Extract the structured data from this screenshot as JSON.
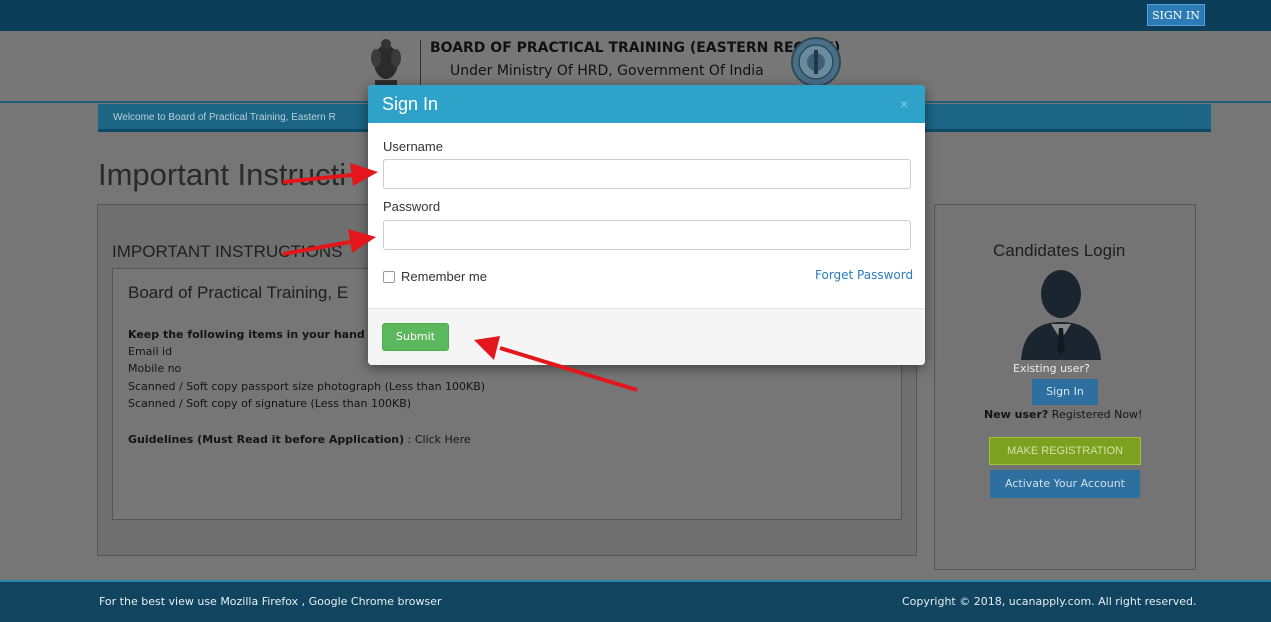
{
  "topbar": {
    "signin_label": "SIGN IN"
  },
  "header": {
    "title": "BOARD OF PRACTICAL TRAINING (EASTERN REGION)",
    "subtitle": "Under Ministry Of HRD, Government Of India"
  },
  "welcome": {
    "text": "Welcome to Board of Practical Training, Eastern R"
  },
  "page": {
    "title": "Important Instructi"
  },
  "instructions": {
    "heading": "IMPORTANT INSTRUCTIONS",
    "inner_title": "Board of Practical Training, E",
    "keep_label": "Keep the following items in your hand b",
    "items": [
      "Email id",
      "Mobile no",
      "Scanned / Soft copy passport size photograph (Less than 100KB)",
      "Scanned / Soft copy of signature (Less than 100KB)"
    ],
    "guidelines_label": "Guidelines (Must Read it before Application)",
    "guidelines_sep": " : ",
    "guidelines_link": "Click Here"
  },
  "login_panel": {
    "title": "Candidates Login",
    "existing_user": "Existing user?",
    "signin_label": "Sign In",
    "new_user_bold": "New user?",
    "new_user_text": " Registered Now!",
    "make_registration": "MAKE REGISTRATION",
    "activate_account": "Activate Your Account"
  },
  "footer": {
    "left": "For the best view use Mozilla Firefox , Google Chrome browser",
    "right": "Copyright © 2018, ucanapply.com. All right reserved."
  },
  "modal": {
    "title": "Sign In",
    "close": "×",
    "username_label": "Username",
    "username_value": "",
    "password_label": "Password",
    "password_value": "",
    "remember_label": "Remember me",
    "forget_label": "Forget Password",
    "submit_label": "Submit"
  },
  "colors": {
    "modal_header": "#2fa2c9",
    "submit": "#5cb85c",
    "arrow": "#e3161b",
    "topbar": "#0c3e5a"
  }
}
